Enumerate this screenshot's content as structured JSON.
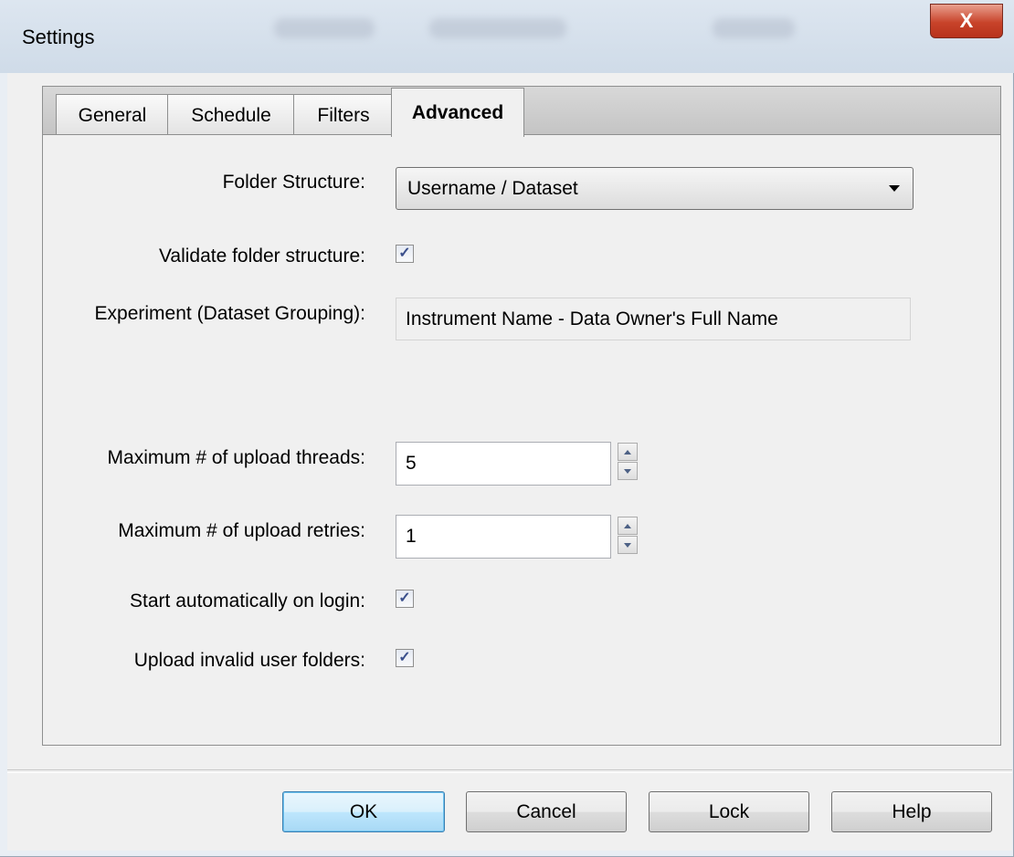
{
  "window": {
    "title": "Settings",
    "close_label": "X"
  },
  "tabs": [
    {
      "label": "General"
    },
    {
      "label": "Schedule"
    },
    {
      "label": "Filters"
    },
    {
      "label": "Advanced",
      "active": true
    }
  ],
  "advanced": {
    "folder_structure_label": "Folder Structure:",
    "folder_structure_value": "Username / Dataset",
    "validate_label": "Validate folder structure:",
    "validate_checked": true,
    "experiment_label": "Experiment (Dataset Grouping):",
    "experiment_value": "Instrument Name - Data Owner's Full Name",
    "max_threads_label": "Maximum # of upload threads:",
    "max_threads_value": "5",
    "max_retries_label": "Maximum # of upload retries:",
    "max_retries_value": "1",
    "start_auto_label": "Start automatically on login:",
    "start_auto_checked": true,
    "upload_invalid_label": "Upload invalid user folders:",
    "upload_invalid_checked": true,
    "check_glyph": "✓"
  },
  "buttons": {
    "ok": "OK",
    "cancel": "Cancel",
    "lock": "Lock",
    "help": "Help"
  },
  "colors": {
    "close_button": "#c8432a",
    "default_button_border": "#3c7fb1"
  }
}
